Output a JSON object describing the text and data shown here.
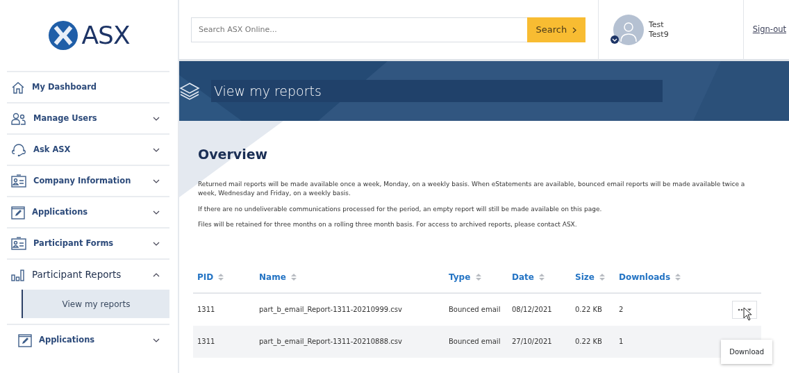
{
  "logo": {
    "text": "ASX"
  },
  "sidebar": {
    "items": [
      {
        "kind": "link",
        "label": "My Dashboard",
        "expanded": false
      },
      {
        "kind": "menu",
        "label": "Manage Users",
        "expanded": false
      },
      {
        "kind": "menu",
        "label": "Ask ASX",
        "expanded": false
      },
      {
        "kind": "menu",
        "label": "Company Information",
        "expanded": false
      },
      {
        "kind": "menu",
        "label": "Applications",
        "expanded": false
      },
      {
        "kind": "menu",
        "label": "Participant Forms",
        "expanded": false
      },
      {
        "kind": "menu",
        "label": "Participant Reports",
        "expanded": true,
        "children": [
          {
            "label": "View my reports",
            "selected": true
          }
        ]
      },
      {
        "kind": "menu",
        "label": "Applications",
        "expanded": false
      }
    ]
  },
  "header": {
    "search": {
      "placeholder": "Search ASX Online...",
      "button": "Search"
    },
    "user": {
      "name": "Test",
      "id": "Test9"
    },
    "sign_out": "Sign-out"
  },
  "banner": {
    "title": "View my reports"
  },
  "overview": {
    "title": "Overview",
    "paragraphs": [
      "Returned mail reports will be made available once a week, Monday, on a weekly basis. When eStatements are available, bounced email reports will be made available twice a week, Wednesday and Friday, on a weekly basis.",
      "If there are no undeliverable communications processed for the period, an empty report will still be made available on this page.",
      "Files will be retained for three months on a rolling three month basis. For access to archived reports, please contact ASX."
    ]
  },
  "table": {
    "columns": [
      "PID",
      "Name",
      "Type",
      "Date",
      "Size",
      "Downloads"
    ],
    "rows": [
      {
        "cells": [
          "1311",
          "part_b_email_Report-1311-20210999.csv",
          "Bounced email",
          "08/12/2021",
          "0.22 KB",
          "2"
        ],
        "menu_open": true,
        "menu_items": [
          "Download"
        ]
      },
      {
        "cells": [
          "1311",
          "part_b_email_Report-1311-20210888.csv",
          "Bounced email",
          "27/10/2021",
          "0.22 KB",
          "1"
        ],
        "menu_open": false
      }
    ]
  }
}
